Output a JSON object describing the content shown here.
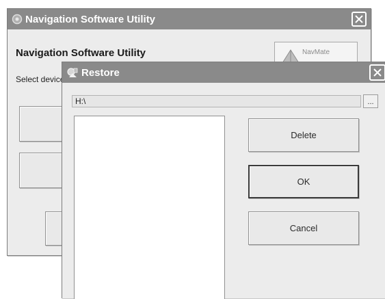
{
  "parent_window": {
    "title": "Navigation Software Utility",
    "heading": "Navigation Software Utility",
    "instruction": "Select device",
    "logo_text": "NavMate"
  },
  "restore_dialog": {
    "title": "Restore",
    "path_value": "H:\\",
    "browse_label": "...",
    "delete_label": "Delete",
    "ok_label": "OK",
    "cancel_label": "Cancel"
  }
}
